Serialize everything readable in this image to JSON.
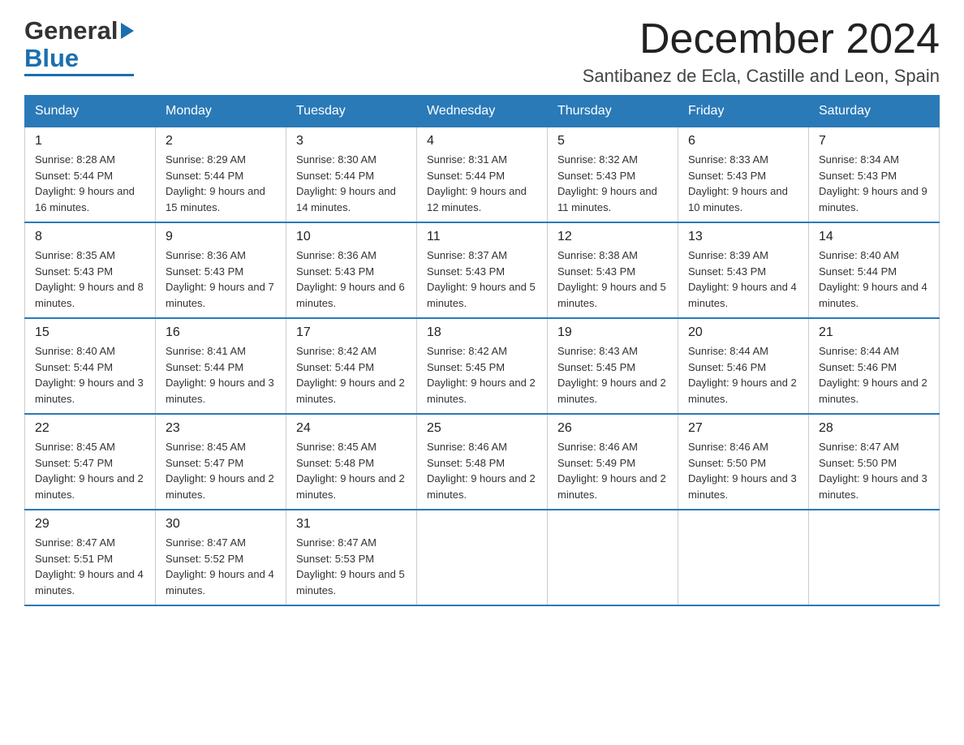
{
  "header": {
    "logo_general": "General",
    "logo_blue": "Blue",
    "main_title": "December 2024",
    "subtitle": "Santibanez de Ecla, Castille and Leon, Spain"
  },
  "calendar": {
    "days_of_week": [
      "Sunday",
      "Monday",
      "Tuesday",
      "Wednesday",
      "Thursday",
      "Friday",
      "Saturday"
    ],
    "weeks": [
      [
        {
          "day": "1",
          "sunrise": "8:28 AM",
          "sunset": "5:44 PM",
          "daylight": "9 hours and 16 minutes."
        },
        {
          "day": "2",
          "sunrise": "8:29 AM",
          "sunset": "5:44 PM",
          "daylight": "9 hours and 15 minutes."
        },
        {
          "day": "3",
          "sunrise": "8:30 AM",
          "sunset": "5:44 PM",
          "daylight": "9 hours and 14 minutes."
        },
        {
          "day": "4",
          "sunrise": "8:31 AM",
          "sunset": "5:44 PM",
          "daylight": "9 hours and 12 minutes."
        },
        {
          "day": "5",
          "sunrise": "8:32 AM",
          "sunset": "5:43 PM",
          "daylight": "9 hours and 11 minutes."
        },
        {
          "day": "6",
          "sunrise": "8:33 AM",
          "sunset": "5:43 PM",
          "daylight": "9 hours and 10 minutes."
        },
        {
          "day": "7",
          "sunrise": "8:34 AM",
          "sunset": "5:43 PM",
          "daylight": "9 hours and 9 minutes."
        }
      ],
      [
        {
          "day": "8",
          "sunrise": "8:35 AM",
          "sunset": "5:43 PM",
          "daylight": "9 hours and 8 minutes."
        },
        {
          "day": "9",
          "sunrise": "8:36 AM",
          "sunset": "5:43 PM",
          "daylight": "9 hours and 7 minutes."
        },
        {
          "day": "10",
          "sunrise": "8:36 AM",
          "sunset": "5:43 PM",
          "daylight": "9 hours and 6 minutes."
        },
        {
          "day": "11",
          "sunrise": "8:37 AM",
          "sunset": "5:43 PM",
          "daylight": "9 hours and 5 minutes."
        },
        {
          "day": "12",
          "sunrise": "8:38 AM",
          "sunset": "5:43 PM",
          "daylight": "9 hours and 5 minutes."
        },
        {
          "day": "13",
          "sunrise": "8:39 AM",
          "sunset": "5:43 PM",
          "daylight": "9 hours and 4 minutes."
        },
        {
          "day": "14",
          "sunrise": "8:40 AM",
          "sunset": "5:44 PM",
          "daylight": "9 hours and 4 minutes."
        }
      ],
      [
        {
          "day": "15",
          "sunrise": "8:40 AM",
          "sunset": "5:44 PM",
          "daylight": "9 hours and 3 minutes."
        },
        {
          "day": "16",
          "sunrise": "8:41 AM",
          "sunset": "5:44 PM",
          "daylight": "9 hours and 3 minutes."
        },
        {
          "day": "17",
          "sunrise": "8:42 AM",
          "sunset": "5:44 PM",
          "daylight": "9 hours and 2 minutes."
        },
        {
          "day": "18",
          "sunrise": "8:42 AM",
          "sunset": "5:45 PM",
          "daylight": "9 hours and 2 minutes."
        },
        {
          "day": "19",
          "sunrise": "8:43 AM",
          "sunset": "5:45 PM",
          "daylight": "9 hours and 2 minutes."
        },
        {
          "day": "20",
          "sunrise": "8:44 AM",
          "sunset": "5:46 PM",
          "daylight": "9 hours and 2 minutes."
        },
        {
          "day": "21",
          "sunrise": "8:44 AM",
          "sunset": "5:46 PM",
          "daylight": "9 hours and 2 minutes."
        }
      ],
      [
        {
          "day": "22",
          "sunrise": "8:45 AM",
          "sunset": "5:47 PM",
          "daylight": "9 hours and 2 minutes."
        },
        {
          "day": "23",
          "sunrise": "8:45 AM",
          "sunset": "5:47 PM",
          "daylight": "9 hours and 2 minutes."
        },
        {
          "day": "24",
          "sunrise": "8:45 AM",
          "sunset": "5:48 PM",
          "daylight": "9 hours and 2 minutes."
        },
        {
          "day": "25",
          "sunrise": "8:46 AM",
          "sunset": "5:48 PM",
          "daylight": "9 hours and 2 minutes."
        },
        {
          "day": "26",
          "sunrise": "8:46 AM",
          "sunset": "5:49 PM",
          "daylight": "9 hours and 2 minutes."
        },
        {
          "day": "27",
          "sunrise": "8:46 AM",
          "sunset": "5:50 PM",
          "daylight": "9 hours and 3 minutes."
        },
        {
          "day": "28",
          "sunrise": "8:47 AM",
          "sunset": "5:50 PM",
          "daylight": "9 hours and 3 minutes."
        }
      ],
      [
        {
          "day": "29",
          "sunrise": "8:47 AM",
          "sunset": "5:51 PM",
          "daylight": "9 hours and 4 minutes."
        },
        {
          "day": "30",
          "sunrise": "8:47 AM",
          "sunset": "5:52 PM",
          "daylight": "9 hours and 4 minutes."
        },
        {
          "day": "31",
          "sunrise": "8:47 AM",
          "sunset": "5:53 PM",
          "daylight": "9 hours and 5 minutes."
        },
        null,
        null,
        null,
        null
      ]
    ]
  }
}
